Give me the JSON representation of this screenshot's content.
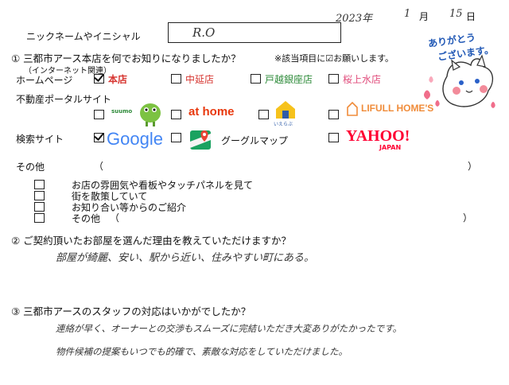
{
  "date": {
    "year": "2023年",
    "month": "1",
    "month_label": "月",
    "day": "15",
    "day_label": "日"
  },
  "nickname": {
    "label": "ニックネームやイニシャル",
    "value": "R.O"
  },
  "sticker": {
    "text_line1": "ありがとう",
    "text_line2": "ございます。"
  },
  "q1": {
    "title": "① 三都市アース本店を何でお知りになりましたか？",
    "note": "※該当項目に☑お願いします。",
    "homepage": {
      "label": "ホームページ",
      "sublabel": "（インターネット関連）",
      "options": [
        {
          "label": "本店",
          "checked": true
        },
        {
          "label": "中延店",
          "checked": false
        },
        {
          "label": "戸越銀座店",
          "checked": false
        },
        {
          "label": "桜上水店",
          "checked": false
        }
      ]
    },
    "portal": {
      "label": "不動産ポータルサイト",
      "options": [
        {
          "label": "suumo",
          "checked": false
        },
        {
          "label": "at home",
          "checked": false
        },
        {
          "label": "いえらぶ",
          "checked": false
        },
        {
          "label": "LIFULL HOME'S",
          "checked": false
        }
      ]
    },
    "search": {
      "label": "検索サイト",
      "options": [
        {
          "label": "Google",
          "checked": true
        },
        {
          "label": "グーグルマップ",
          "checked": false
        },
        {
          "label": "YAHOO!",
          "sublabel": "JAPAN",
          "checked": false
        }
      ]
    },
    "other": {
      "label": "その他",
      "open": "（",
      "close": "）"
    },
    "other_options": [
      {
        "label": "お店の雰囲気や看板やタッチパネルを見て",
        "checked": false
      },
      {
        "label": "街を散策していて",
        "checked": false
      },
      {
        "label": "お知り合い等からのご紹介",
        "checked": false
      },
      {
        "label": "その他",
        "open": "（",
        "close": "）",
        "checked": false
      }
    ]
  },
  "q2": {
    "title": "② ご契約頂いたお部屋を選んだ理由を教えていただけますか？",
    "answer": "部屋が綺麗、安い、駅から近い、住みやすい町にある。"
  },
  "q3": {
    "title": "③ 三都市アースのスタッフの対応はいかがでしたか？",
    "answer_line1": "連絡が早く、オーナーとの交渉もスムーズに完結いただき大変ありがたかったです。",
    "answer_line2": "物件候補の提案もいつでも的確で、素敵な対応をしていただけました。"
  },
  "colors": {
    "red": "#d6342f",
    "green": "#2e8b3a",
    "pink": "#e04a7a",
    "google_blue": "#4285f4",
    "yahoo_red": "#ff0033"
  }
}
